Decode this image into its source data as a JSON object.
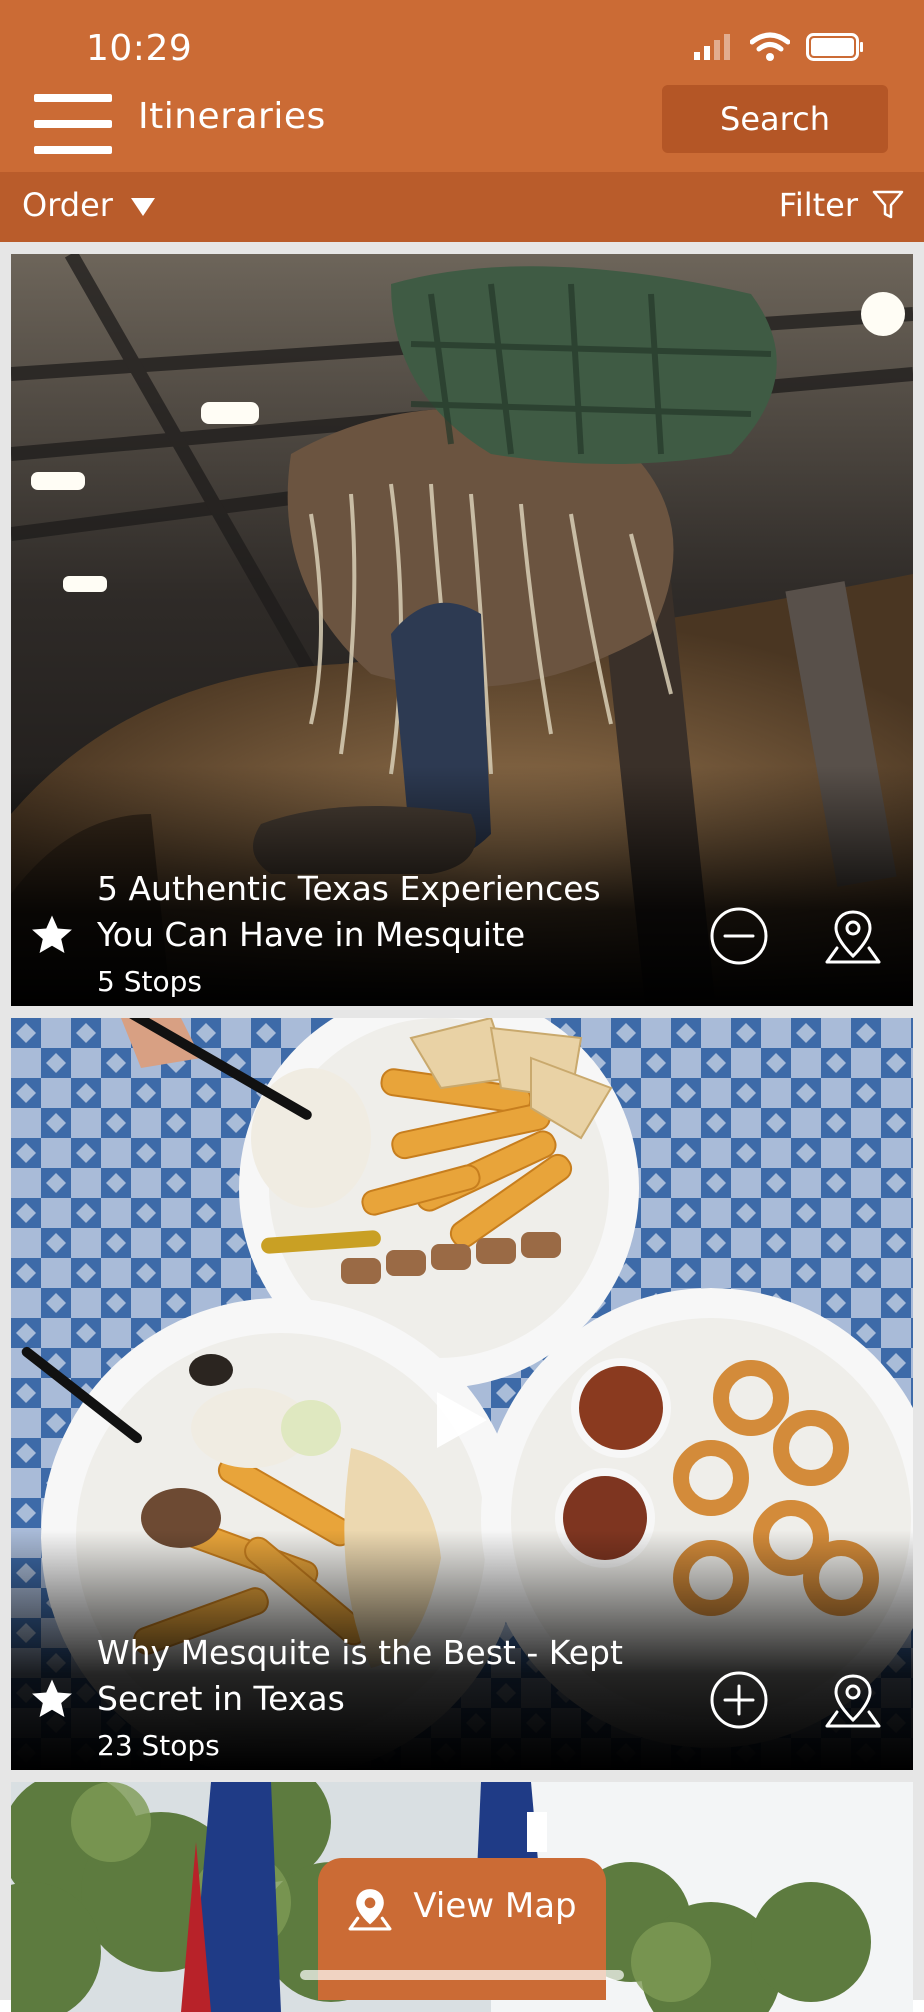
{
  "status_bar": {
    "time": "10:29"
  },
  "header": {
    "title": "Itineraries",
    "search_label": "Search"
  },
  "toolbar": {
    "order_label": "Order",
    "filter_label": "Filter"
  },
  "cards": [
    {
      "title": "5 Authentic Texas Experiences You Can Have in Mesquite",
      "stops": "5 Stops",
      "action": "minus-circle-icon"
    },
    {
      "title": "Why Mesquite is the Best - Kept Secret in Texas",
      "stops": "23 Stops",
      "action": "plus-circle-icon"
    }
  ],
  "view_map": {
    "label": "View Map"
  },
  "colors": {
    "primary": "#CB6B35",
    "toolbar": "#B95C2B",
    "search_button": "#B45626"
  }
}
